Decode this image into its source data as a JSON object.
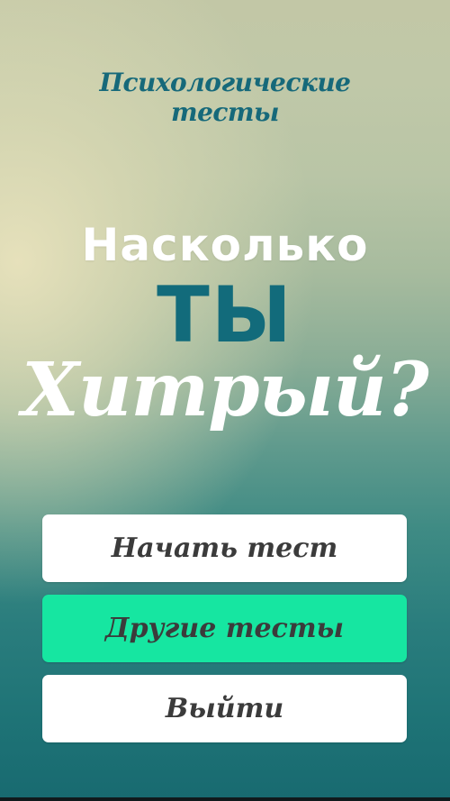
{
  "header": {
    "subtitle_line_1": "Психологические",
    "subtitle_line_2": "тесты"
  },
  "headline": {
    "line_1": "Насколько",
    "line_2": "ТЫ",
    "line_3": "Хитрый?"
  },
  "menu": {
    "start_label": "Начать тест",
    "other_tests_label": "Другие тесты",
    "exit_label": "Выйти"
  },
  "colors": {
    "title_teal": "#16697a",
    "accent_button": "#16e6a1",
    "button_white": "#ffffff",
    "button_text": "#3b3b3b"
  }
}
